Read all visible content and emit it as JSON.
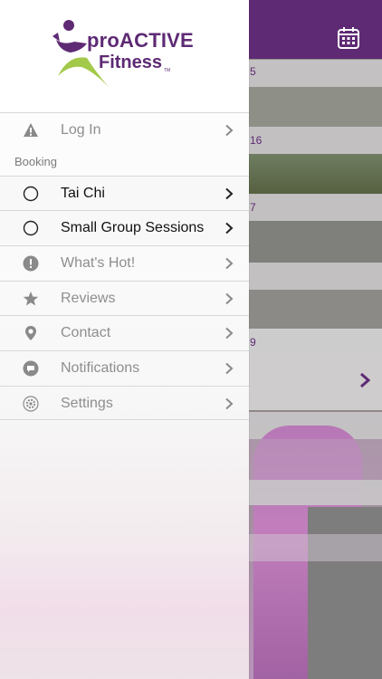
{
  "logo": {
    "line1": "proACTIVE",
    "line2": "Fitness",
    "tm": "TM"
  },
  "menu": {
    "login": "Log In",
    "section_booking": "Booking",
    "tai_chi": "Tai Chi",
    "small_group": "Small Group Sessions",
    "whats_hot": "What's Hot!",
    "reviews": "Reviews",
    "contact": "Contact",
    "notifications": "Notifications",
    "settings": "Settings"
  },
  "background": {
    "dates": [
      "5",
      "16",
      "7",
      "9"
    ]
  },
  "colors": {
    "brand": "#5e2a74",
    "logo_green": "#a2c94a",
    "icon_grey": "#8a8a8a"
  },
  "icons": {
    "login": "warning-icon",
    "tai_chi": "circle-icon",
    "small_group": "circle-icon",
    "whats_hot": "exclamation-icon",
    "reviews": "star-icon",
    "contact": "location-pin-icon",
    "notifications": "chat-bubble-icon",
    "settings": "gear-icon",
    "calendar": "calendar-icon"
  }
}
